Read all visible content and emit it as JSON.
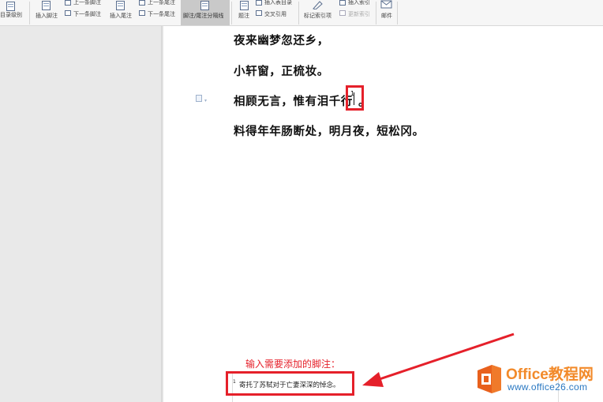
{
  "toolbar": {
    "toc_level": "目录级别",
    "insert_footnote": "插入脚注",
    "prev_footnote": "上一条脚注",
    "next_footnote": "下一条脚注",
    "insert_endnote": "插入尾注",
    "prev_endnote": "上一条尾注",
    "next_endnote": "下一条尾注",
    "separator_line": "脚注/尾注分隔线",
    "caption": "题注",
    "insert_toc_table": "插入表目录",
    "cross_ref": "交叉引用",
    "mark_index": "标记索引项",
    "insert_index": "插入索引",
    "update_index": "更新索引",
    "mail": "邮件"
  },
  "document": {
    "lines": [
      "夜来幽梦忽还乡，",
      "小轩窗，正梳妆。",
      "相顾无言，惟有泪千行",
      "料得年年肠断处，明月夜，短松冈。"
    ],
    "footnote_ref": "1",
    "period": "。",
    "annotation": "输入需要添加的脚注：",
    "footnote_number": "1",
    "footnote_text": "寄托了苏轼对于亡妻深深的悼念。"
  },
  "watermark": {
    "title": "Office教程网",
    "url": "www.office26.com"
  },
  "colors": {
    "highlight": "#e5202a",
    "watermark_orange": "#f28a2a",
    "watermark_blue": "#2a78c2"
  }
}
